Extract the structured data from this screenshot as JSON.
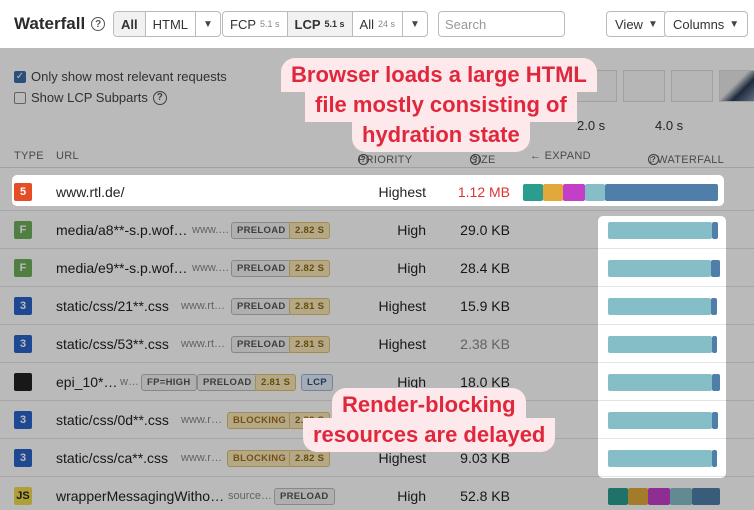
{
  "toolbar": {
    "title": "Waterfall",
    "filter": [
      "All",
      "HTML"
    ],
    "metrics": [
      {
        "label": "FCP",
        "value": "5.1 s"
      },
      {
        "label": "LCP",
        "value": "5.1 s"
      },
      {
        "label": "All",
        "value": "24 s"
      }
    ],
    "search_placeholder": "Search",
    "view_label": "View",
    "columns_label": "Columns"
  },
  "options": {
    "relevant_label": "Only show most relevant requests",
    "relevant_checked": true,
    "lcp_subparts_label": "Show LCP Subparts",
    "lcp_subparts_checked": false
  },
  "timeline": {
    "ticks": [
      "2.0 s",
      "4.0 s"
    ]
  },
  "table_header": {
    "type": "TYPE",
    "url": "URL",
    "priority": "PRIORITY",
    "size": "SIZE",
    "expand": "← EXPAND",
    "waterfall": "↓ WATERFALL"
  },
  "rows": [
    {
      "type": "html",
      "icon": "5",
      "url": "www.rtl.de/",
      "domain": "",
      "tags": [],
      "priority": "Highest",
      "size": "1.12 MB"
    },
    {
      "type": "font",
      "icon": "F",
      "url": "media/a8**-s.p.wof…",
      "domain": "www.…",
      "tags": [
        "PRELOAD",
        "2.82 S"
      ],
      "priority": "High",
      "size": "29.0 KB"
    },
    {
      "type": "font",
      "icon": "F",
      "url": "media/e9**-s.p.wof…",
      "domain": "www.…",
      "tags": [
        "PRELOAD",
        "2.82 S"
      ],
      "priority": "High",
      "size": "28.4 KB"
    },
    {
      "type": "css",
      "icon": "3",
      "url": "static/css/21**.css",
      "domain": "www.rt…",
      "tags": [
        "PRELOAD",
        "2.81 S"
      ],
      "priority": "Highest",
      "size": "15.9 KB"
    },
    {
      "type": "css",
      "icon": "3",
      "url": "static/css/53**.css",
      "domain": "www.rt…",
      "tags": [
        "PRELOAD",
        "2.81 S"
      ],
      "priority": "Highest",
      "size": "2.38 KB"
    },
    {
      "type": "img",
      "icon": "",
      "url": "epi_10*…",
      "domain": "w…",
      "tags": [
        "FP=HIGH",
        "PRELOAD",
        "2.81 S",
        "LCP"
      ],
      "priority": "High",
      "size": "18.0 KB"
    },
    {
      "type": "css",
      "icon": "3",
      "url": "static/css/0d**.css",
      "domain": "www.r…",
      "tags": [
        "BLOCKING",
        "2.82 S"
      ],
      "priority": "Highest",
      "size": "…"
    },
    {
      "type": "css",
      "icon": "3",
      "url": "static/css/ca**.css",
      "domain": "www.r…",
      "tags": [
        "BLOCKING",
        "2.82 S"
      ],
      "priority": "Highest",
      "size": "9.03 KB"
    },
    {
      "type": "js",
      "icon": "JS",
      "url": "wrapperMessagingWitho…",
      "domain": "source…",
      "tags": [
        "PRELOAD"
      ],
      "priority": "High",
      "size": "52.8 KB"
    }
  ],
  "callouts": {
    "html": [
      "Browser loads a large HTML",
      "file mostly consisting of",
      "hydration state"
    ],
    "blocking": [
      "Render-blocking",
      "resources are delayed"
    ]
  },
  "colors": {
    "accent": "#e0283c",
    "bar_teal": "#86bec8",
    "bar_dark": "#4f7ea8"
  }
}
